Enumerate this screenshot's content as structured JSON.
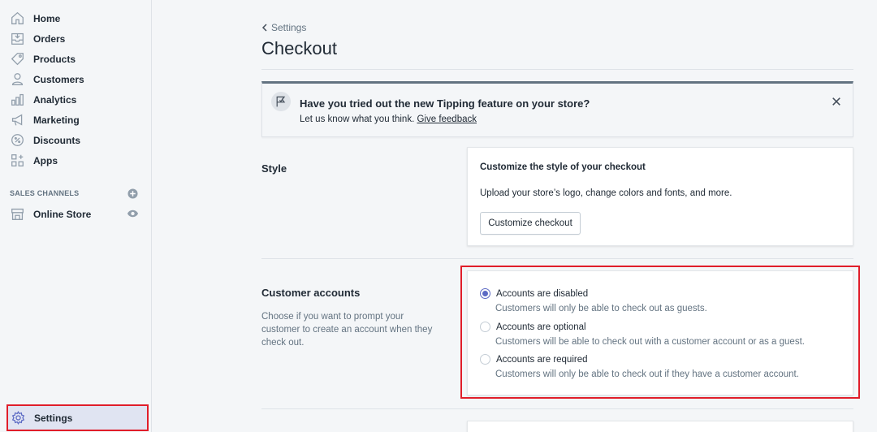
{
  "sidebar": {
    "items": [
      {
        "label": "Home",
        "icon": "home-icon"
      },
      {
        "label": "Orders",
        "icon": "orders-icon"
      },
      {
        "label": "Products",
        "icon": "tag-icon"
      },
      {
        "label": "Customers",
        "icon": "person-icon"
      },
      {
        "label": "Analytics",
        "icon": "bar-chart-icon"
      },
      {
        "label": "Marketing",
        "icon": "megaphone-icon"
      },
      {
        "label": "Discounts",
        "icon": "discount-icon"
      },
      {
        "label": "Apps",
        "icon": "apps-icon"
      }
    ],
    "sales_channels_heading": "SALES CHANNELS",
    "online_store": "Online Store",
    "settings": "Settings"
  },
  "breadcrumb": "Settings",
  "page_title": "Checkout",
  "banner": {
    "title": "Have you tried out the new Tipping feature on your store?",
    "text": "Let us know what you think.",
    "link": "Give feedback"
  },
  "style_section": {
    "label": "Style",
    "card_title": "Customize the style of your checkout",
    "card_text": "Upload your store’s logo, change colors and fonts, and more.",
    "button": "Customize checkout"
  },
  "accounts_section": {
    "label": "Customer accounts",
    "description": "Choose if you want to prompt your customer to create an account when they check out.",
    "options": [
      {
        "label": "Accounts are disabled",
        "help": "Customers will only be able to check out as guests.",
        "selected": true
      },
      {
        "label": "Accounts are optional",
        "help": "Customers will be able to check out with a customer account or as a guest.",
        "selected": false
      },
      {
        "label": "Accounts are required",
        "help": "Customers will only be able to check out if they have a customer account.",
        "selected": false
      }
    ]
  },
  "colors": {
    "accent": "#5c6ac4",
    "highlight": "#e01e2a"
  }
}
